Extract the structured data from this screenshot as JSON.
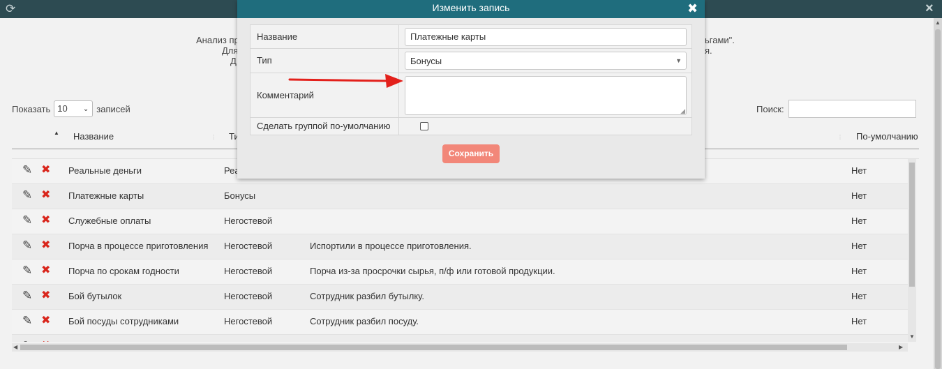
{
  "intro": {
    "line1_left": "Анализ пр",
    "line1_right": "ьгами\".",
    "line2_left": "Для",
    "line2_right": "я.",
    "line3_left": "Д"
  },
  "table_controls": {
    "show_label": "Показать",
    "page_size": "10",
    "records_label": "записей",
    "search_label": "Поиск:"
  },
  "table": {
    "headers": {
      "name": "Название",
      "type": "Ти",
      "default": "По-умолчанию"
    },
    "rows": [
      {
        "name": "Реальные деньги",
        "type": "Реа",
        "comment": "",
        "default": "Нет"
      },
      {
        "name": "Платежные карты",
        "type": "Бонусы",
        "comment": "",
        "default": "Нет"
      },
      {
        "name": "Служебные оплаты",
        "type": "Негостевой",
        "comment": "",
        "default": "Нет"
      },
      {
        "name": "Порча в процессе приготовления",
        "type": "Негостевой",
        "comment": "Испортили в процессе приготовления.",
        "default": "Нет"
      },
      {
        "name": "Порча по срокам годности",
        "type": "Негостевой",
        "comment": "Порча из-за просрочки сырья, п/ф или готовой продукции.",
        "default": "Нет"
      },
      {
        "name": "Бой бутылок",
        "type": "Негостевой",
        "comment": "Сотрудник разбил бутылку.",
        "default": "Нет"
      },
      {
        "name": "Бой посуды сотрудниками",
        "type": "Негостевой",
        "comment": "Сотрудник разбил посуду.",
        "default": "Нет"
      }
    ]
  },
  "modal": {
    "title": "Изменить запись",
    "fields": {
      "name_label": "Название",
      "name_value": "Платежные карты",
      "type_label": "Тип",
      "type_value": "Бонусы",
      "comment_label": "Комментарий",
      "comment_value": "",
      "default_label": "Сделать группой по-умолчанию",
      "default_checked": false
    },
    "save_label": "Сохранить"
  },
  "colors": {
    "modal_header": "#1f6d7d",
    "topbar": "#2d4b52",
    "save_button": "#f28779",
    "delete_icon": "#d9261c",
    "annotation_arrow": "#e3201b"
  },
  "icons": {
    "refresh": "refresh-icon",
    "close": "close-icon",
    "edit": "pencil-icon",
    "delete": "delete-x-icon"
  }
}
